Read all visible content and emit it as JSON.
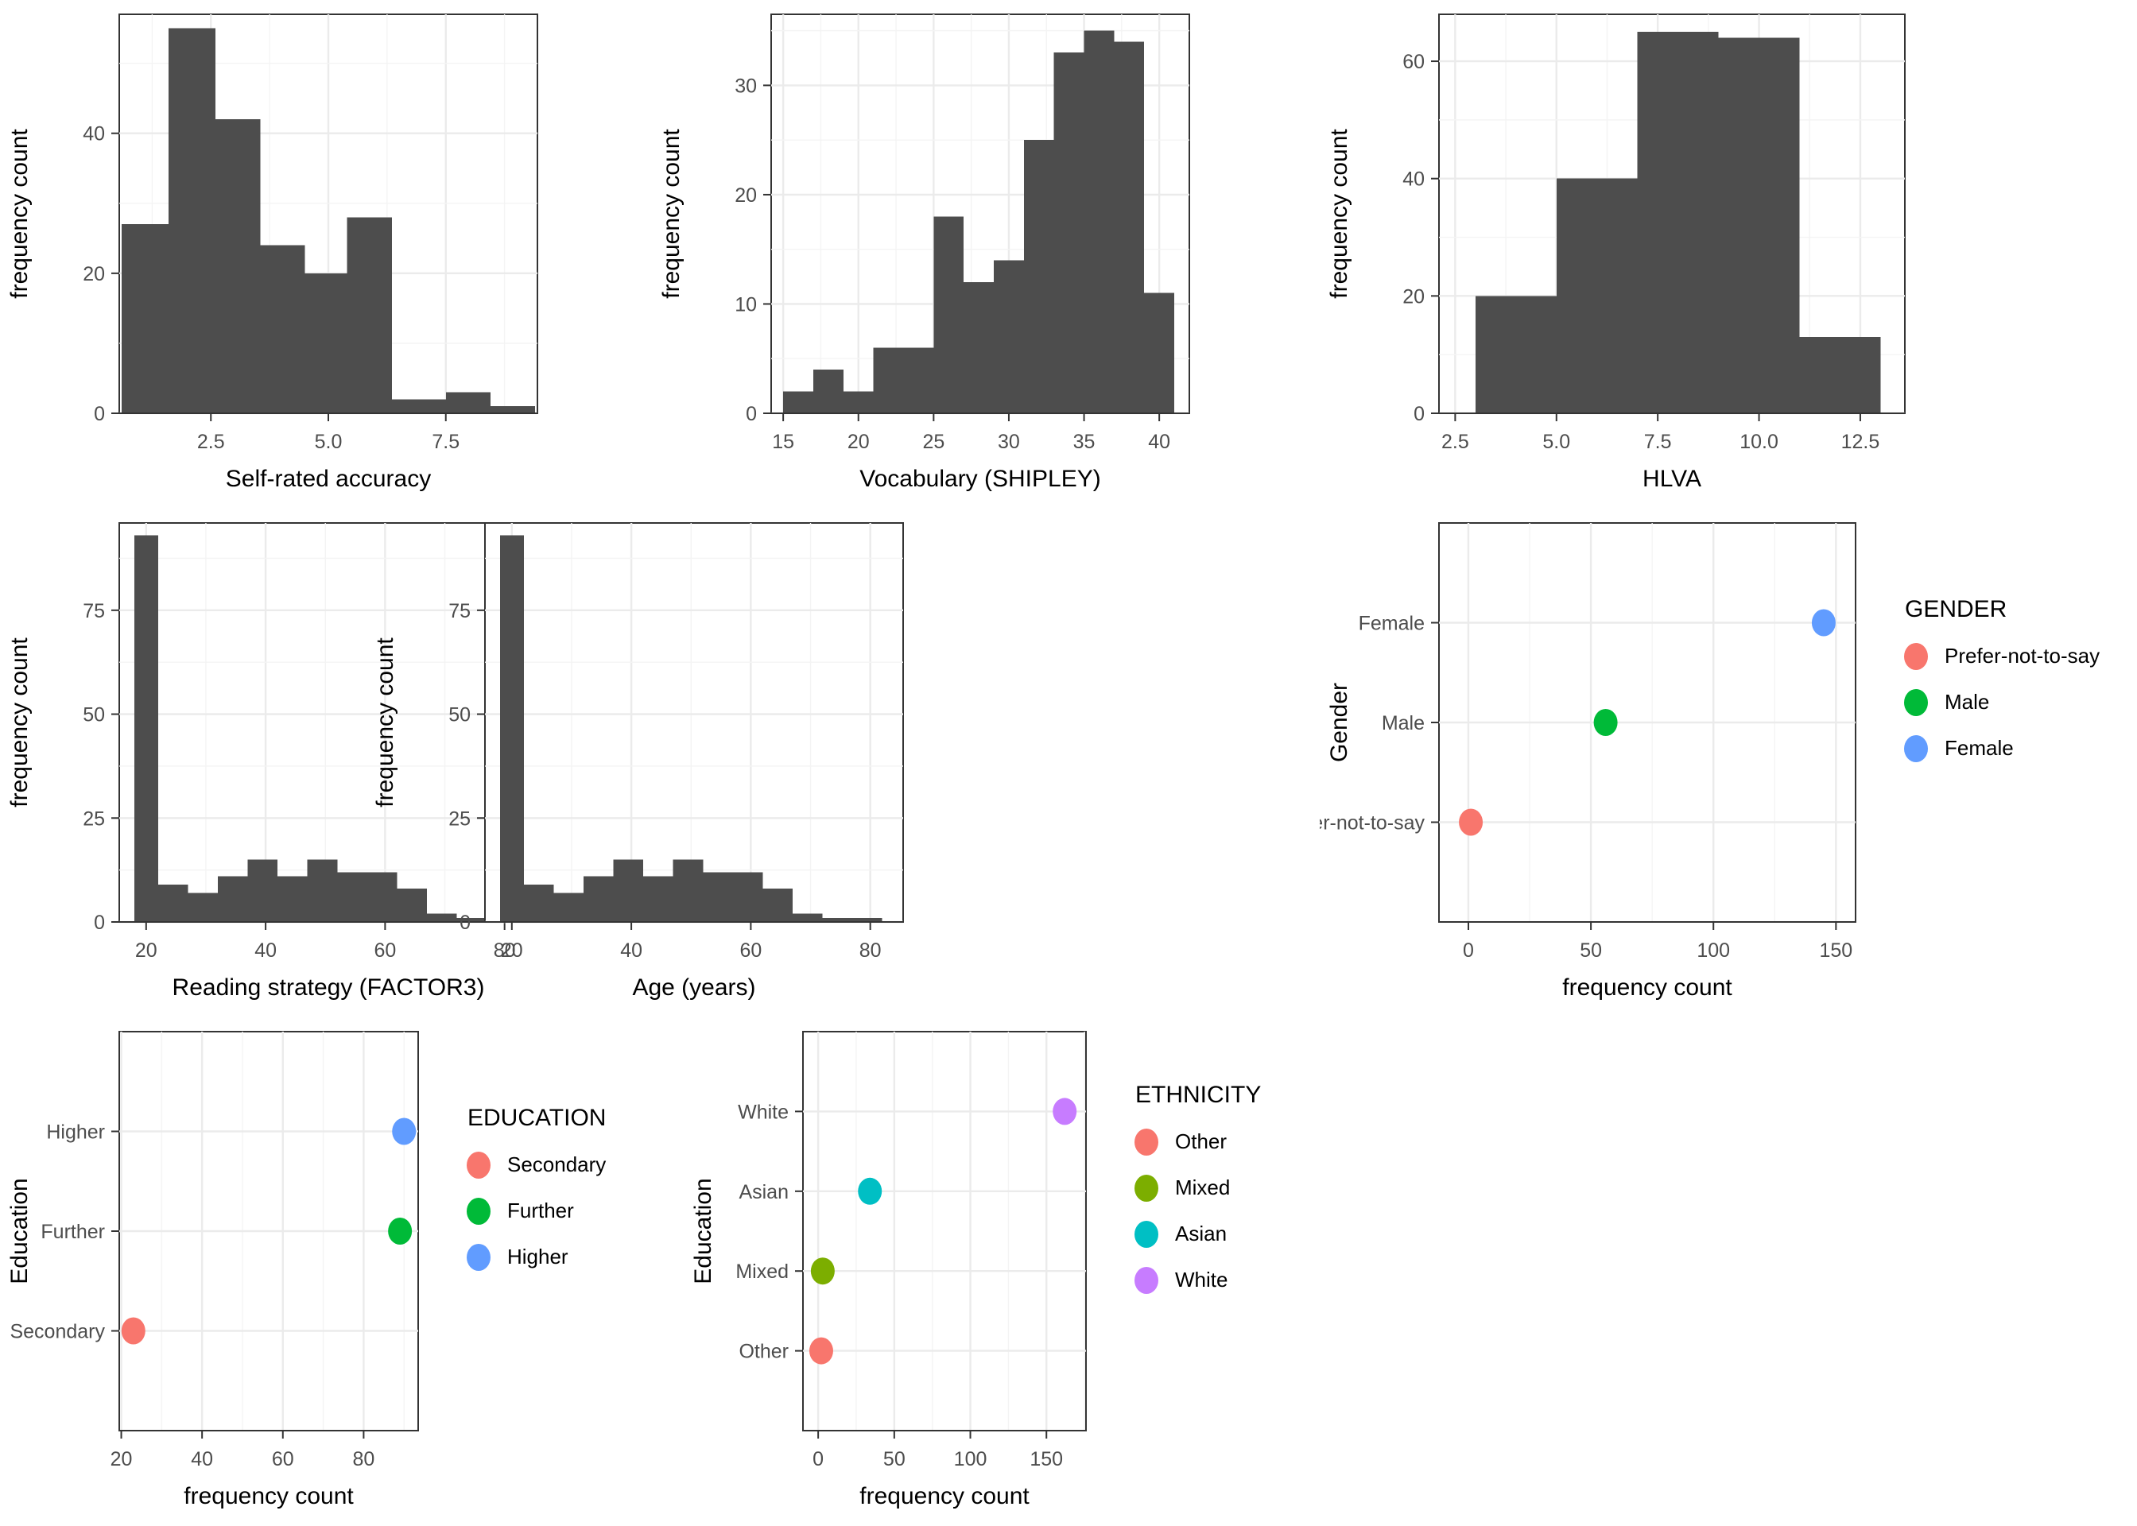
{
  "figure": {
    "background": "#ffffff",
    "histogram_fill": "#4d4d4d",
    "panel_border": "#333333",
    "grid_major": "#ebebeb",
    "grid_minor": "#f4f4f4"
  },
  "chart_data": [
    {
      "id": "self-rated-accuracy",
      "type": "bar",
      "subtype": "histogram",
      "title": "",
      "xlabel": "Self-rated accuracy",
      "ylabel": "frequency count",
      "fill": "#4d4d4d",
      "xlim": [
        0.55,
        9.45
      ],
      "ylim": [
        0,
        57
      ],
      "xticks": [
        2.5,
        5.0,
        7.5
      ],
      "xtick_labels": [
        "2.5",
        "5.0",
        "7.5"
      ],
      "xminor": [
        1.25,
        3.75,
        6.25,
        8.75
      ],
      "yticks": [
        0,
        20,
        40
      ],
      "ytick_labels": [
        "0",
        "20",
        "40"
      ],
      "yminor": [
        10,
        30,
        50
      ],
      "bin_edges": [
        0.6,
        1.6,
        2.1,
        3.15,
        4.05,
        4.75,
        5.4,
        6.4,
        7.3,
        8.4,
        9.4
      ],
      "bins": [
        {
          "x0": 0.6,
          "x1": 1.6,
          "value": 27
        },
        {
          "x0": 1.6,
          "x1": 2.6,
          "value": 55
        },
        {
          "x0": 2.6,
          "x1": 3.55,
          "value": 42
        },
        {
          "x0": 3.55,
          "x1": 4.5,
          "value": 24
        },
        {
          "x0": 4.5,
          "x1": 5.4,
          "value": 20
        },
        {
          "x0": 5.4,
          "x1": 6.35,
          "value": 28
        },
        {
          "x0": 6.35,
          "x1": 7.5,
          "value": 2
        },
        {
          "x0": 7.5,
          "x1": 8.45,
          "value": 3
        },
        {
          "x0": 8.45,
          "x1": 9.4,
          "value": 1
        }
      ]
    },
    {
      "id": "vocabulary-shipley",
      "type": "bar",
      "subtype": "histogram",
      "title": "",
      "xlabel": "Vocabulary (SHIPLEY)",
      "ylabel": "frequency count",
      "fill": "#4d4d4d",
      "xlim": [
        14.2,
        42.0
      ],
      "ylim": [
        0,
        36.5
      ],
      "xticks": [
        15,
        20,
        25,
        30,
        35,
        40
      ],
      "xtick_labels": [
        "15",
        "20",
        "25",
        "30",
        "35",
        "40"
      ],
      "xminor": [
        17.5,
        22.5,
        27.5,
        32.5,
        37.5
      ],
      "yticks": [
        0,
        10,
        20,
        30
      ],
      "ytick_labels": [
        "0",
        "10",
        "20",
        "30"
      ],
      "yminor": [
        5,
        15,
        25,
        35
      ],
      "bin_edges": [
        15,
        17,
        19,
        21,
        23,
        25,
        27,
        29,
        31,
        33,
        35,
        37,
        39,
        41
      ],
      "bins": [
        {
          "x0": 15,
          "x1": 17,
          "value": 2
        },
        {
          "x0": 17,
          "x1": 19,
          "value": 4
        },
        {
          "x0": 19,
          "x1": 21,
          "value": 2
        },
        {
          "x0": 21,
          "x1": 23,
          "value": 6
        },
        {
          "x0": 23,
          "x1": 25,
          "value": 6
        },
        {
          "x0": 25,
          "x1": 27,
          "value": 18
        },
        {
          "x0": 27,
          "x1": 29,
          "value": 12
        },
        {
          "x0": 29,
          "x1": 31,
          "value": 14
        },
        {
          "x0": 31,
          "x1": 33,
          "value": 25
        },
        {
          "x0": 33,
          "x1": 35,
          "value": 33
        },
        {
          "x0": 35,
          "x1": 37,
          "value": 35
        },
        {
          "x0": 37,
          "x1": 39,
          "value": 34
        },
        {
          "x0": 39,
          "x1": 41,
          "value": 11
        }
      ]
    },
    {
      "id": "hlva",
      "type": "bar",
      "subtype": "histogram",
      "title": "",
      "xlabel": "HLVA",
      "ylabel": "frequency count",
      "fill": "#4d4d4d",
      "xlim": [
        2.1,
        13.6
      ],
      "ylim": [
        0,
        68
      ],
      "xticks": [
        2.5,
        5.0,
        7.5,
        10.0,
        12.5
      ],
      "xtick_labels": [
        "2.5",
        "5.0",
        "7.5",
        "10.0",
        "12.5"
      ],
      "xminor": [
        3.75,
        6.25,
        8.75,
        11.25
      ],
      "yticks": [
        0,
        20,
        40,
        60
      ],
      "ytick_labels": [
        "0",
        "20",
        "40",
        "60"
      ],
      "yminor": [
        10,
        30,
        50
      ],
      "bin_edges": [
        3,
        5,
        7,
        9,
        11,
        13
      ],
      "bins": [
        {
          "x0": 3,
          "x1": 5,
          "value": 20
        },
        {
          "x0": 5,
          "x1": 7,
          "value": 40
        },
        {
          "x0": 7,
          "x1": 9,
          "value": 65
        },
        {
          "x0": 9,
          "x1": 11,
          "value": 64
        },
        {
          "x0": 11,
          "x1": 13,
          "value": 13
        }
      ]
    },
    {
      "id": "reading-strategy-factor3",
      "type": "bar",
      "subtype": "histogram",
      "title": "",
      "xlabel": "Reading strategy (FACTOR3)",
      "ylabel": "frequency count",
      "fill": "#4d4d4d",
      "xlim": [
        15.5,
        85.5
      ],
      "ylim": [
        0,
        96
      ],
      "xticks": [
        20,
        40,
        60,
        80
      ],
      "xtick_labels": [
        "20",
        "40",
        "60",
        "80"
      ],
      "xminor": [
        30,
        50,
        70
      ],
      "yticks": [
        0,
        25,
        50,
        75
      ],
      "ytick_labels": [
        "0",
        "25",
        "50",
        "75"
      ],
      "yminor": [
        12.5,
        37.5,
        62.5,
        87.5
      ],
      "bin_edges": [
        18,
        22,
        27,
        32,
        37,
        42,
        47,
        52,
        57,
        62,
        67,
        72,
        77,
        82
      ],
      "bins": [
        {
          "x0": 18,
          "x1": 22,
          "value": 93
        },
        {
          "x0": 22,
          "x1": 27,
          "value": 9
        },
        {
          "x0": 27,
          "x1": 32,
          "value": 7
        },
        {
          "x0": 32,
          "x1": 37,
          "value": 11
        },
        {
          "x0": 37,
          "x1": 42,
          "value": 15
        },
        {
          "x0": 42,
          "x1": 47,
          "value": 11
        },
        {
          "x0": 47,
          "x1": 52,
          "value": 15
        },
        {
          "x0": 52,
          "x1": 57,
          "value": 12
        },
        {
          "x0": 57,
          "x1": 62,
          "value": 12
        },
        {
          "x0": 62,
          "x1": 67,
          "value": 8
        },
        {
          "x0": 67,
          "x1": 72,
          "value": 2
        },
        {
          "x0": 72,
          "x1": 77,
          "value": 1
        },
        {
          "x0": 77,
          "x1": 82,
          "value": 1
        }
      ]
    },
    {
      "id": "age-years",
      "type": "bar",
      "subtype": "histogram",
      "title": "",
      "xlabel": "Age (years)",
      "ylabel": "frequency count",
      "fill": "#4d4d4d",
      "xlim": [
        15.5,
        85.5
      ],
      "ylim": [
        0,
        96
      ],
      "xticks": [
        20,
        40,
        60,
        80
      ],
      "xtick_labels": [
        "20",
        "40",
        "60",
        "80"
      ],
      "xminor": [
        30,
        50,
        70
      ],
      "yticks": [
        0,
        25,
        50,
        75
      ],
      "ytick_labels": [
        "0",
        "25",
        "50",
        "75"
      ],
      "yminor": [
        12.5,
        37.5,
        62.5,
        87.5
      ],
      "bin_edges": [
        18,
        22,
        27,
        32,
        37,
        42,
        47,
        52,
        57,
        62,
        67,
        72,
        77,
        82
      ],
      "bins": [
        {
          "x0": 18,
          "x1": 22,
          "value": 93
        },
        {
          "x0": 22,
          "x1": 27,
          "value": 9
        },
        {
          "x0": 27,
          "x1": 32,
          "value": 7
        },
        {
          "x0": 32,
          "x1": 37,
          "value": 11
        },
        {
          "x0": 37,
          "x1": 42,
          "value": 15
        },
        {
          "x0": 42,
          "x1": 47,
          "value": 11
        },
        {
          "x0": 47,
          "x1": 52,
          "value": 15
        },
        {
          "x0": 52,
          "x1": 57,
          "value": 12
        },
        {
          "x0": 57,
          "x1": 62,
          "value": 12
        },
        {
          "x0": 62,
          "x1": 67,
          "value": 8
        },
        {
          "x0": 67,
          "x1": 72,
          "value": 2
        },
        {
          "x0": 72,
          "x1": 77,
          "value": 1
        },
        {
          "x0": 77,
          "x1": 82,
          "value": 1
        }
      ]
    },
    {
      "id": "gender",
      "type": "scatter",
      "title": "",
      "xlabel": "frequency count",
      "ylabel": "Gender",
      "legend_title": "GENDER",
      "legend_position": "right",
      "xlim": [
        -12,
        158
      ],
      "xticks": [
        0,
        50,
        100,
        150
      ],
      "xtick_labels": [
        "0",
        "50",
        "100",
        "150"
      ],
      "xminor": [
        25,
        75,
        125
      ],
      "categories": [
        "Prefer-not-to-say",
        "Male",
        "Female"
      ],
      "points": [
        {
          "label": "Prefer-not-to-say",
          "value": 1,
          "color": "#f8766d"
        },
        {
          "label": "Male",
          "value": 56,
          "color": "#00ba38"
        },
        {
          "label": "Female",
          "value": 145,
          "color": "#619cff"
        }
      ],
      "legend": [
        {
          "label": "Prefer-not-to-say",
          "color": "#f8766d"
        },
        {
          "label": "Male",
          "color": "#00ba38"
        },
        {
          "label": "Female",
          "color": "#619cff"
        }
      ]
    },
    {
      "id": "education",
      "type": "scatter",
      "title": "",
      "xlabel": "frequency count",
      "ylabel": "Education",
      "legend_title": "EDUCATION",
      "legend_position": "right",
      "xlim": [
        19.5,
        93.5
      ],
      "xticks": [
        20,
        40,
        60,
        80
      ],
      "xtick_labels": [
        "20",
        "40",
        "60",
        "80"
      ],
      "xminor": [
        30,
        50,
        70,
        90
      ],
      "categories": [
        "Secondary",
        "Further",
        "Higher"
      ],
      "points": [
        {
          "label": "Secondary",
          "value": 23,
          "color": "#f8766d"
        },
        {
          "label": "Further",
          "value": 89,
          "color": "#00ba38"
        },
        {
          "label": "Higher",
          "value": 90,
          "color": "#619cff"
        }
      ],
      "legend": [
        {
          "label": "Secondary",
          "color": "#f8766d"
        },
        {
          "label": "Further",
          "color": "#00ba38"
        },
        {
          "label": "Higher",
          "color": "#619cff"
        }
      ]
    },
    {
      "id": "ethnicity",
      "type": "scatter",
      "title": "",
      "xlabel": "frequency count",
      "ylabel": "Education",
      "legend_title": "ETHNICITY",
      "legend_position": "right",
      "xlim": [
        -10,
        176
      ],
      "xticks": [
        0,
        50,
        100,
        150
      ],
      "xtick_labels": [
        "0",
        "50",
        "100",
        "150"
      ],
      "xminor": [
        25,
        75,
        125,
        175
      ],
      "categories": [
        "Other",
        "Mixed",
        "Asian",
        "White"
      ],
      "points": [
        {
          "label": "Other",
          "value": 2,
          "color": "#f8766d"
        },
        {
          "label": "Mixed",
          "value": 3,
          "color": "#7cae00"
        },
        {
          "label": "Asian",
          "value": 34,
          "color": "#00bfc4"
        },
        {
          "label": "White",
          "value": 162,
          "color": "#c77cff"
        }
      ],
      "legend": [
        {
          "label": "Other",
          "color": "#f8766d"
        },
        {
          "label": "Mixed",
          "color": "#7cae00"
        },
        {
          "label": "Asian",
          "color": "#00bfc4"
        },
        {
          "label": "White",
          "color": "#c77cff"
        }
      ]
    }
  ]
}
